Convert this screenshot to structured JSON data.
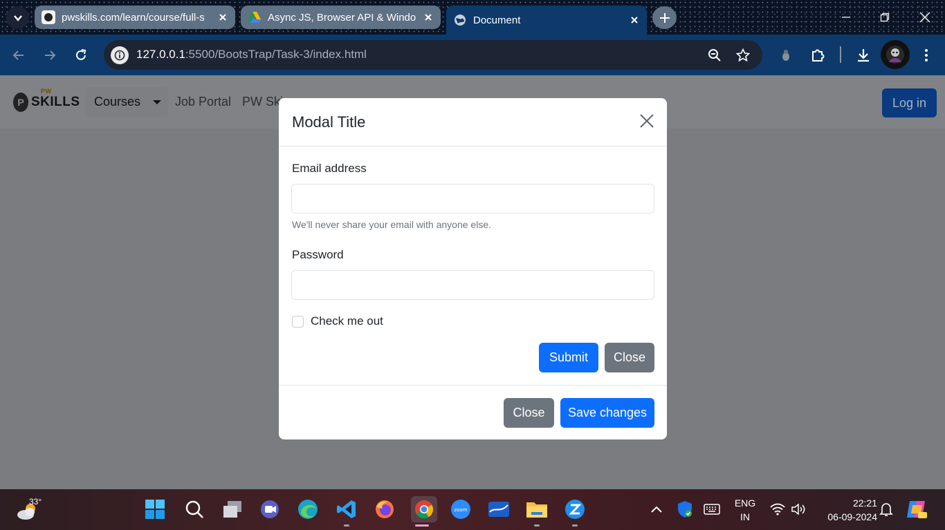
{
  "browser": {
    "tabs": [
      {
        "title": "pwskills.com/learn/course/full-s",
        "active": false
      },
      {
        "title": "Async JS, Browser API & Windo",
        "active": false
      },
      {
        "title": "Document",
        "active": true
      }
    ],
    "url_host": "127.0.0.1",
    "url_path": ":5500/BootsTrap/Task-3/index.html"
  },
  "navbar": {
    "logo_text": "SKILLS",
    "logo_badge": "PW",
    "courses": "Courses",
    "job_portal": "Job Portal",
    "pw_skills": "PW Ski",
    "login": "Log in"
  },
  "modal": {
    "title": "Modal Title",
    "email_label": "Email address",
    "email_value": "",
    "email_help": "We'll never share your email with anyone else.",
    "password_label": "Password",
    "password_value": "",
    "check_label": "Check me out",
    "submit": "Submit",
    "close_inline": "Close",
    "footer_close": "Close",
    "save_changes": "Save changes"
  },
  "taskbar": {
    "weather_temp": "33°",
    "lang_top": "ENG",
    "lang_bottom": "IN",
    "time": "22:21",
    "date": "06-09-2024"
  },
  "colors": {
    "primary": "#0d6efd",
    "secondary": "#6c757d",
    "chrome_toolbar": "#0d3a6a",
    "backdrop": "#7a7c7f"
  }
}
